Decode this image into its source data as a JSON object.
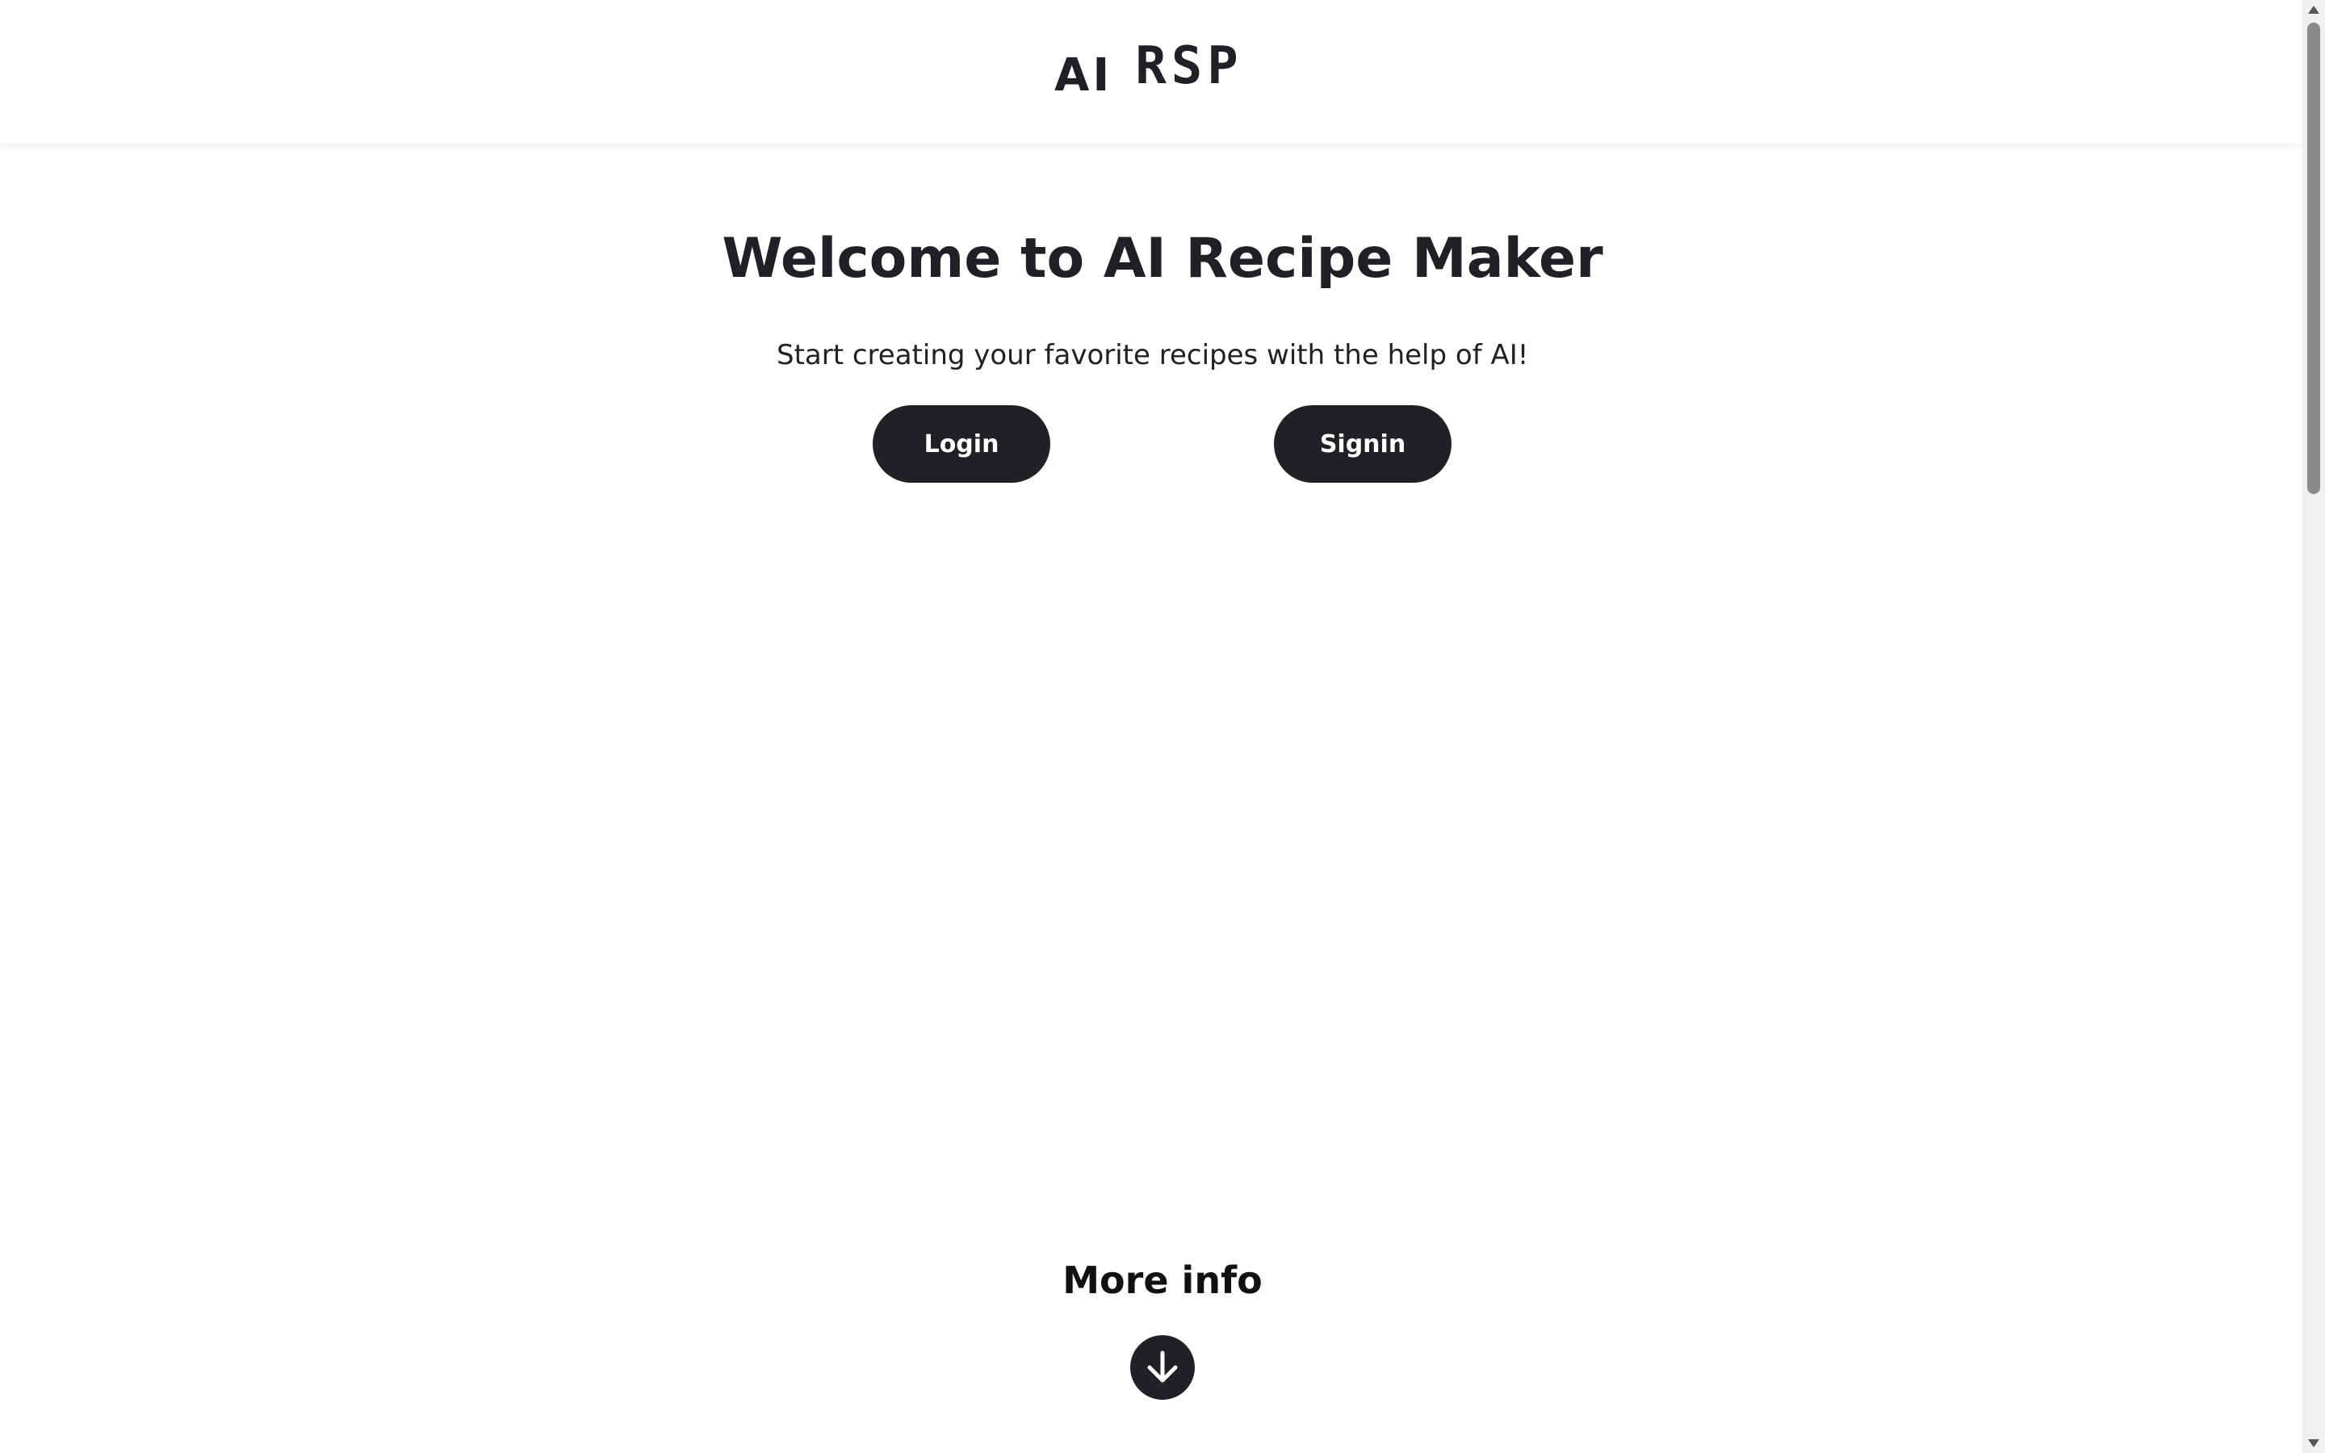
{
  "header": {
    "logo_ai": "AI",
    "logo_rsp": "RSP"
  },
  "hero": {
    "title": "Welcome to AI Recipe Maker",
    "subtitle": "Start creating your favorite recipes with the help of AI!",
    "login_label": "Login",
    "signin_label": "Signin"
  },
  "footer_section": {
    "more_info_label": "More info",
    "scroll_icon": "arrow-down-circle-icon"
  },
  "colors": {
    "primary_dark": "#202125",
    "background": "#ffffff",
    "button_text": "#ffffff"
  }
}
